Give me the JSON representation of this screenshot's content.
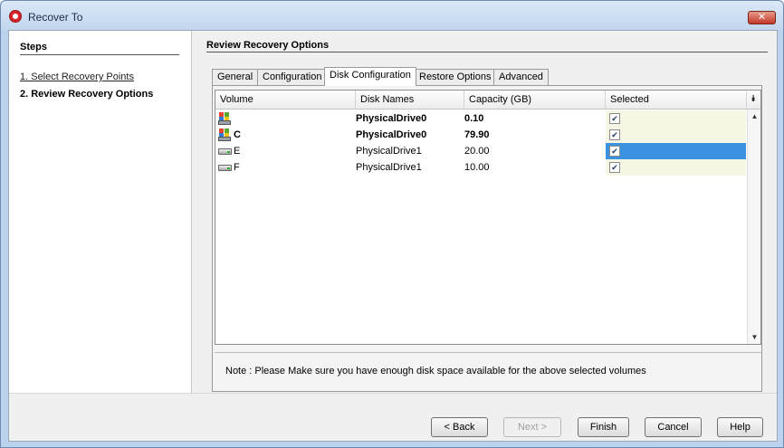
{
  "window": {
    "title": "Recover To",
    "close_label": "✕"
  },
  "steps": {
    "title": "Steps",
    "items": [
      {
        "label": "1. Select Recovery Points"
      },
      {
        "label": "2. Review Recovery Options"
      }
    ]
  },
  "main": {
    "title": "Review Recovery Options",
    "tabs": [
      {
        "label": "General"
      },
      {
        "label": "Configuration"
      },
      {
        "label": "Disk Configuration"
      },
      {
        "label": "Restore Options"
      },
      {
        "label": "Advanced"
      }
    ],
    "active_tab": "Disk Configuration"
  },
  "table": {
    "columns": [
      "Volume",
      "Disk Names",
      "Capacity (GB)",
      "Selected"
    ],
    "menu_icon": "double-chevron-down-icon",
    "rows": [
      {
        "icon": "windows-system-volume-icon",
        "volume": "",
        "disk": "PhysicalDrive0",
        "capacity": "0.10",
        "selected": true
      },
      {
        "icon": "windows-system-volume-icon",
        "volume": "C",
        "disk": "PhysicalDrive0",
        "capacity": "79.90",
        "selected": true
      },
      {
        "icon": "hard-drive-icon",
        "volume": "E",
        "disk": "PhysicalDrive1",
        "capacity": "20.00",
        "selected": true
      },
      {
        "icon": "hard-drive-icon",
        "volume": "F",
        "disk": "PhysicalDrive1",
        "capacity": "10.00",
        "selected": true
      }
    ]
  },
  "note": "Note : Please Make sure you have enough disk space available for the above selected volumes",
  "buttons": {
    "back": "< Back",
    "next": "Next >",
    "finish": "Finish",
    "cancel": "Cancel",
    "help": "Help"
  },
  "colors": {
    "selection_highlight": "#3b92de",
    "selected_column_bg": "#f6f6e4",
    "window_frame": "#bcd3ee"
  }
}
